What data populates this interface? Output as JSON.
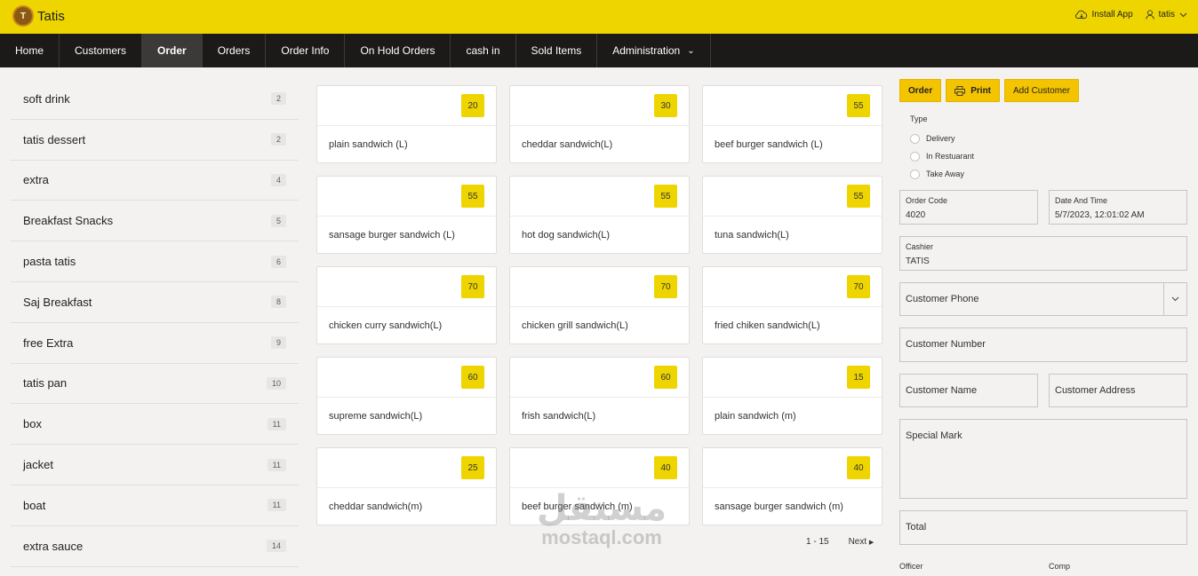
{
  "app": {
    "title": "Tatis",
    "logo_text": "T"
  },
  "topbar": {
    "install_label": "Install App",
    "user_label": "tatis"
  },
  "nav": [
    {
      "label": "Home"
    },
    {
      "label": "Customers"
    },
    {
      "label": "Order",
      "active": true
    },
    {
      "label": "Orders"
    },
    {
      "label": "Order Info"
    },
    {
      "label": "On Hold Orders"
    },
    {
      "label": "cash in"
    },
    {
      "label": "Sold Items"
    },
    {
      "label": "Administration",
      "dropdown": true
    }
  ],
  "categories": [
    {
      "label": "soft drink",
      "count": "2"
    },
    {
      "label": "tatis dessert",
      "count": "2"
    },
    {
      "label": "extra",
      "count": "4"
    },
    {
      "label": "Breakfast Snacks",
      "count": "5"
    },
    {
      "label": "pasta tatis",
      "count": "6"
    },
    {
      "label": "Saj Breakfast",
      "count": "8"
    },
    {
      "label": "free Extra",
      "count": "9"
    },
    {
      "label": "tatis pan",
      "count": "10"
    },
    {
      "label": "box",
      "count": "11"
    },
    {
      "label": "jacket",
      "count": "11"
    },
    {
      "label": "boat",
      "count": "11"
    },
    {
      "label": "extra sauce",
      "count": "14"
    }
  ],
  "products": [
    {
      "name": "plain sandwich (L)",
      "price": "20"
    },
    {
      "name": "cheddar sandwich(L)",
      "price": "30"
    },
    {
      "name": "beef burger sandwich (L)",
      "price": "55"
    },
    {
      "name": "sansage burger sandwich (L)",
      "price": "55"
    },
    {
      "name": "hot dog sandwich(L)",
      "price": "55"
    },
    {
      "name": "tuna sandwich(L)",
      "price": "55"
    },
    {
      "name": "chicken curry sandwich(L)",
      "price": "70"
    },
    {
      "name": "chicken grill sandwich(L)",
      "price": "70"
    },
    {
      "name": "fried chiken sandwich(L)",
      "price": "70"
    },
    {
      "name": "supreme sandwich(L)",
      "price": "60"
    },
    {
      "name": "frish sandwich(L)",
      "price": "60"
    },
    {
      "name": "plain sandwich (m)",
      "price": "15"
    },
    {
      "name": "cheddar sandwich(m)",
      "price": "25"
    },
    {
      "name": "beef burger sandwich (m)",
      "price": "40"
    },
    {
      "name": "sansage burger sandwich (m)",
      "price": "40"
    }
  ],
  "pager": {
    "range": "1 - 15",
    "next_label": "Next"
  },
  "actions": {
    "order_label": "Order",
    "print_label": "Print",
    "add_customer_label": "Add Customer"
  },
  "order_type": {
    "label": "Type",
    "options": [
      "Delivery",
      "In Restuarant",
      "Take Away"
    ]
  },
  "form": {
    "order_code_label": "Order Code",
    "order_code_value": "4020",
    "datetime_label": "Date And Time",
    "datetime_value": "5/7/2023, 12:01:02 AM",
    "cashier_label": "Cashier",
    "cashier_value": "TATIS",
    "customer_phone_placeholder": "Customer Phone",
    "customer_number_placeholder": "Customer Number",
    "customer_name_placeholder": "Customer Name",
    "customer_address_placeholder": "Customer Address",
    "special_mark_placeholder": "Special Mark",
    "total_placeholder": "Total",
    "officer_label": "Officer",
    "comp_label": "Comp"
  },
  "watermark": {
    "arabic": "مستقل",
    "latin": "mostaql.com"
  },
  "colors": {
    "accent": "#eed500",
    "nav_bg": "#1b1a19",
    "button": "#f4c400"
  }
}
